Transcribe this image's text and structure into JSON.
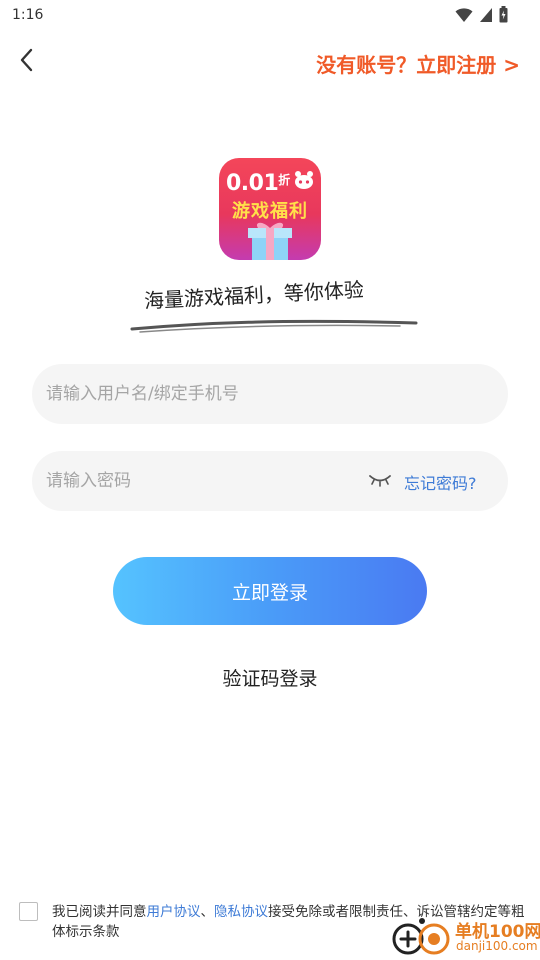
{
  "status_bar": {
    "time": "1:16"
  },
  "header": {
    "register_link": "没有账号？立即注册 >"
  },
  "logo": {
    "line1": "0.01",
    "line1_suffix": "折",
    "line2": "游戏福利"
  },
  "slogan": "海量游戏福利，等你体验",
  "form": {
    "username_placeholder": "请输入用户名/绑定手机号",
    "username_value": "",
    "password_placeholder": "请输入密码",
    "password_value": "",
    "forgot_label": "忘记密码?",
    "login_label": "立即登录",
    "sms_login_label": "验证码登录"
  },
  "agreement": {
    "prefix": "我已阅读并同意",
    "user_agreement": "用户协议",
    "separator": "、",
    "privacy_agreement": "隐私协议",
    "suffix": "接受免除或者限制责任、诉讼管辖约定等粗体标示条款",
    "checked": false
  },
  "watermark": {
    "name": "单机100网",
    "domain": "danji100.com"
  },
  "colors": {
    "accent_orange": "#f05a28",
    "link_blue": "#3e7bd6",
    "button_gradient_start": "#55c3ff",
    "button_gradient_end": "#4a7af2"
  },
  "icons": {
    "back": "chevron-left-icon",
    "eye": "eye-closed-icon",
    "wifi": "wifi-icon",
    "signal": "signal-icon",
    "battery": "battery-icon"
  }
}
